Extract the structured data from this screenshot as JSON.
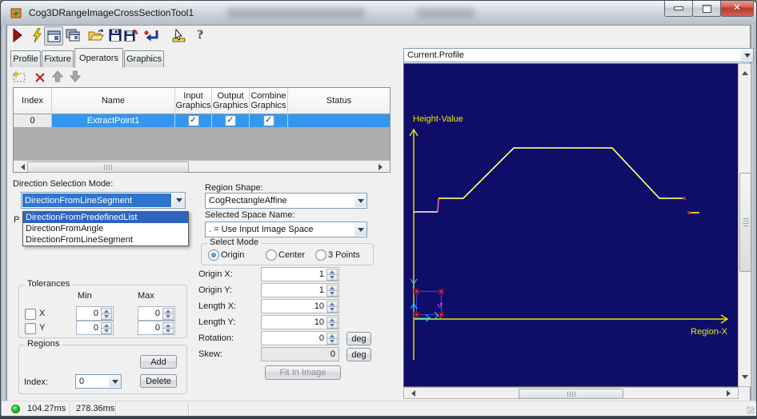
{
  "window": {
    "title": "Cog3DRangeImageCrossSectionTool1"
  },
  "toolbar": {
    "icons": [
      "run",
      "lightning",
      "show-controls",
      "copy-controls",
      "open-file",
      "save-file",
      "save-as",
      "reset",
      "probe",
      "help"
    ]
  },
  "tabs": {
    "items": [
      "Profile",
      "Fixture",
      "Operators",
      "Graphics"
    ],
    "selected": "Operators"
  },
  "operators": {
    "table": {
      "columns": [
        "Index",
        "Name",
        "Input Graphics",
        "Output Graphics",
        "Combine Graphics",
        "Status"
      ],
      "row": {
        "index": "0",
        "name": "ExtractPoint1",
        "input_checked": true,
        "output_checked": true,
        "combine_checked": true,
        "status": ""
      }
    }
  },
  "direction": {
    "label": "Direction Selection Mode:",
    "value": "DirectionFromLineSegment",
    "options": [
      "DirectionFromPredefinedList",
      "DirectionFromAngle",
      "DirectionFromLineSegment"
    ],
    "hidden_fragment": "P"
  },
  "region": {
    "shape_label": "Region Shape:",
    "shape_value": "CogRectangleAffine",
    "space_label": "Selected Space Name:",
    "space_value": ". = Use Input Image Space",
    "select_mode": {
      "legend": "Select Mode",
      "options": [
        "Origin",
        "Center",
        "3 Points"
      ],
      "selected": "Origin"
    },
    "fields": [
      {
        "label": "Origin X:",
        "value": "1"
      },
      {
        "label": "Origin Y:",
        "value": "1"
      },
      {
        "label": "Length X:",
        "value": "10"
      },
      {
        "label": "Length Y:",
        "value": "10"
      },
      {
        "label": "Rotation:",
        "value": "0",
        "unit": "deg"
      },
      {
        "label": "Skew:",
        "value": "0",
        "unit": "deg"
      }
    ],
    "fit_button": "Fit In Image"
  },
  "tolerances": {
    "legend": "Tolerances",
    "min_header": "Min",
    "max_header": "Max",
    "rows": [
      {
        "label": "X",
        "min": "0",
        "max": "0"
      },
      {
        "label": "Y",
        "min": "0",
        "max": "0"
      }
    ]
  },
  "regions_group": {
    "legend": "Regions",
    "add_button": "Add",
    "delete_button": "Delete",
    "index_label": "Index:",
    "index_value": "0"
  },
  "display": {
    "selector": "Current.Profile",
    "y_axis_label": "Height-Value",
    "x_axis_label": "Region-X",
    "colors": {
      "background": "#0e0e68",
      "axis": "#f2e400",
      "profile_white": "#ffffff",
      "profile_yellow": "#ffff00",
      "step_pink": "#ff5fae",
      "marker_red": "#d42a2a",
      "region_cyan": "#19e0ff",
      "region_blue": "#3b3bd8",
      "handle_red": "#7c1216",
      "handle_magenta": "#ff40ff"
    },
    "profile": {
      "segments": [
        {
          "color": "#ffffff",
          "points": [
            [
              12,
              185
            ],
            [
              42,
              185
            ]
          ]
        },
        {
          "color": "#ff5fae",
          "points": [
            [
              42,
              185
            ],
            [
              43,
              168
            ]
          ]
        },
        {
          "color": "#ffffff",
          "points": [
            [
              43,
              168
            ],
            [
              74,
              168
            ],
            [
              137,
              105
            ],
            [
              260,
              105
            ],
            [
              319,
              168
            ],
            [
              350,
              168
            ]
          ]
        },
        {
          "color": "#ffff00",
          "dash": "8 7",
          "points": [
            [
              43,
              168
            ],
            [
              74,
              168
            ],
            [
              137,
              105
            ],
            [
              260,
              105
            ],
            [
              319,
              168
            ],
            [
              350,
              168
            ]
          ]
        },
        {
          "color": "#ffff00",
          "points": [
            [
              356,
              186
            ],
            [
              369,
              186
            ]
          ]
        }
      ],
      "markers": [
        [
          350,
          168
        ],
        [
          356,
          186
        ]
      ]
    }
  },
  "status_bar": {
    "time_1": "104.27ms",
    "time_2": "278.36ms"
  },
  "ui": {
    "check": "✓"
  }
}
